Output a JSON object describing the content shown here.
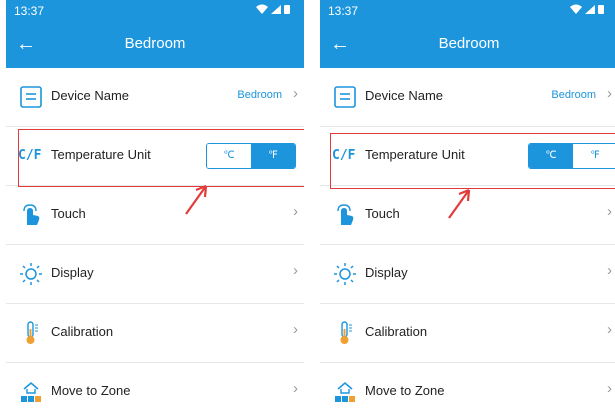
{
  "colors": {
    "accent": "#1c95dd",
    "highlight": "#e23b3b",
    "divider": "#e6e6e6"
  },
  "phones": [
    {
      "status_time": "13:37",
      "status_icons": [
        "wifi-icon",
        "signal-icon",
        "battery-icon"
      ],
      "title": "Bedroom",
      "rows": [
        {
          "label": "Device Name",
          "value": "Bedroom",
          "icon": "device-name-icon"
        },
        {
          "label": "Temperature Unit",
          "icon_text": "C/F",
          "unit_options": [
            "℃",
            "℉"
          ],
          "selected_unit": "℉"
        },
        {
          "label": "Touch",
          "icon": "touch-icon"
        },
        {
          "label": "Display",
          "icon": "display-sun-icon"
        },
        {
          "label": "Calibration",
          "icon": "thermometer-icon"
        },
        {
          "label": "Move to Zone",
          "icon": "move-to-zone-icon"
        }
      ]
    },
    {
      "status_time": "13:37",
      "status_icons": [
        "wifi-icon",
        "signal-icon",
        "battery-icon"
      ],
      "title": "Bedroom",
      "rows": [
        {
          "label": "Device Name",
          "value": "Bedroom",
          "icon": "device-name-icon"
        },
        {
          "label": "Temperature Unit",
          "icon_text": "C/F",
          "unit_options": [
            "℃",
            "℉"
          ],
          "selected_unit": "℃"
        },
        {
          "label": "Touch",
          "icon": "touch-icon"
        },
        {
          "label": "Display",
          "icon": "display-sun-icon"
        },
        {
          "label": "Calibration",
          "icon": "thermometer-icon"
        },
        {
          "label": "Move to Zone",
          "icon": "move-to-zone-icon"
        }
      ]
    }
  ]
}
